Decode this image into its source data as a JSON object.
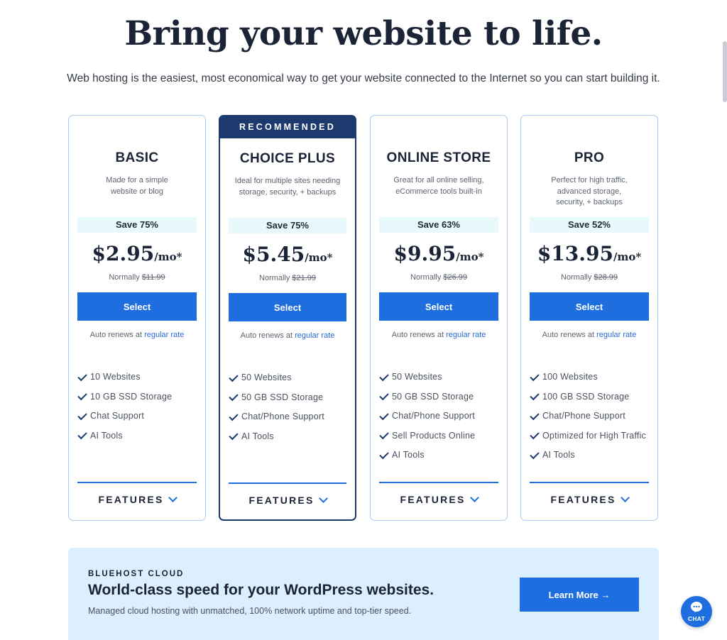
{
  "hero": {
    "title": "Bring your website to life.",
    "subtitle": "Web hosting is the easiest, most economical way to get your website connected to the Internet so you can start building it."
  },
  "common": {
    "select_label": "Select",
    "renew_text": "Auto renews at ",
    "renew_link": "regular rate",
    "normally_label": "Normally ",
    "features_label": "FEATURES",
    "per_month": "/mo*"
  },
  "recommended_label": "RECOMMENDED",
  "plans": [
    {
      "name": "BASIC",
      "desc_lines": [
        "Made for a simple",
        "website or blog"
      ],
      "save": "Save 75%",
      "price": "$2.95",
      "normal_price": "$11.99",
      "features": [
        "10 Websites",
        "10 GB SSD Storage",
        "Chat Support",
        "AI Tools"
      ]
    },
    {
      "name": "CHOICE PLUS",
      "desc_lines": [
        "Ideal for multiple sites needing",
        "storage, security, + backups"
      ],
      "save": "Save 75%",
      "price": "$5.45",
      "normal_price": "$21.99",
      "features": [
        "50 Websites",
        "50 GB SSD Storage",
        "Chat/Phone Support",
        "AI Tools"
      ]
    },
    {
      "name": "ONLINE STORE",
      "desc_lines": [
        "Great for all online selling,",
        "eCommerce tools built-in"
      ],
      "save": "Save 63%",
      "price": "$9.95",
      "normal_price": "$26.99",
      "features": [
        "50 Websites",
        "50 GB SSD Storage",
        "Chat/Phone Support",
        "Sell Products Online",
        "AI Tools"
      ]
    },
    {
      "name": "PRO",
      "desc_lines": [
        "Perfect for high traffic,",
        "advanced storage,",
        "security, + backups"
      ],
      "save": "Save 52%",
      "price": "$13.95",
      "normal_price": "$28.99",
      "features": [
        "100 Websites",
        "100 GB SSD Storage",
        "Chat/Phone Support",
        "Optimized for High Traffic",
        "AI Tools"
      ]
    }
  ],
  "cloud": {
    "eyebrow": "BLUEHOST CLOUD",
    "title": "World-class speed for your WordPress websites.",
    "subtitle": "Managed cloud hosting with unmatched, 100% network uptime and top-tier speed.",
    "button": "Learn More →"
  },
  "chat": {
    "label": "CHAT"
  },
  "colors": {
    "accent": "#1e6ee0",
    "navy": "#1c3a6e",
    "save_band": "#e8f9fb",
    "banner_bg": "#dcefff"
  }
}
